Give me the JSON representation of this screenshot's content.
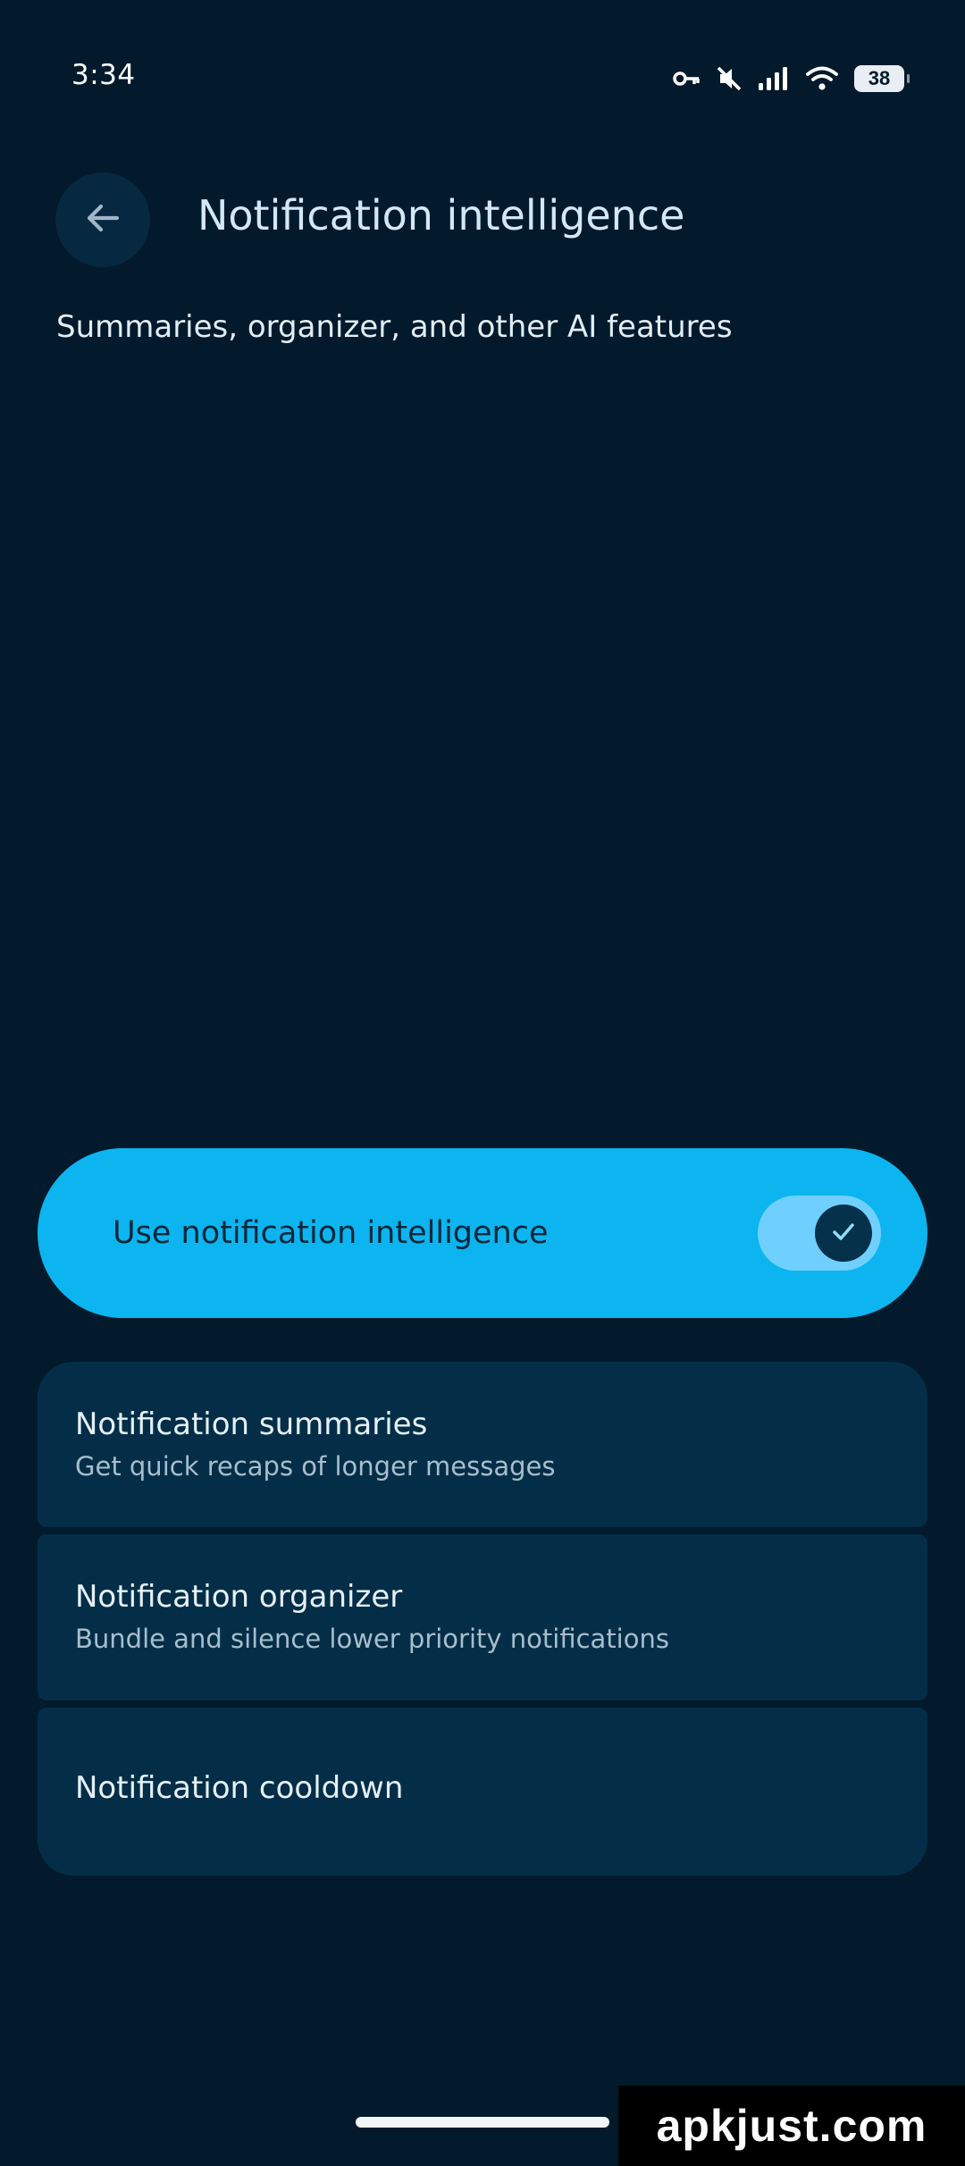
{
  "status_bar": {
    "time": "3:34",
    "battery": "38",
    "icons": [
      "vpn-key-icon",
      "mute-icon",
      "signal-icon",
      "wifi-icon",
      "battery-icon"
    ]
  },
  "header": {
    "back_icon": "arrow-left-icon",
    "title": "Notification intelligence",
    "subtitle": "Summaries, organizer, and other AI features"
  },
  "main_toggle": {
    "label": "Use notification intelligence",
    "enabled": true,
    "thumb_icon": "check-icon"
  },
  "settings": [
    {
      "title": "Notification summaries",
      "description": "Get quick recaps of longer messages"
    },
    {
      "title": "Notification organizer",
      "description": "Bundle and silence lower priority notifications"
    },
    {
      "title": "Notification cooldown"
    }
  ],
  "watermark": "apkjust.com",
  "colors": {
    "background": "#021a2b",
    "accent": "#0cb5ef",
    "card": "#042e47"
  }
}
